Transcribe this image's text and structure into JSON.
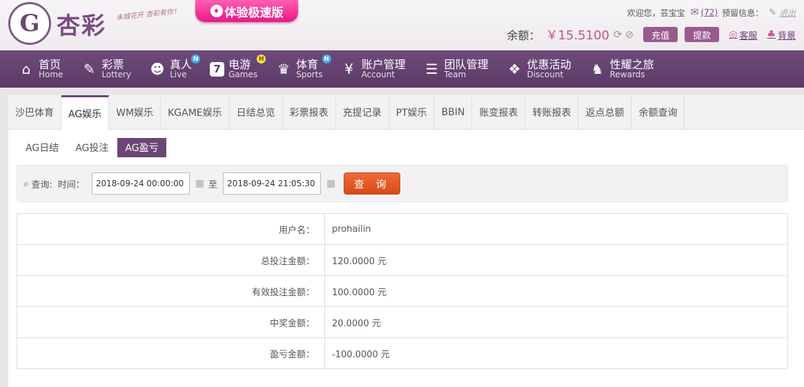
{
  "brand": {
    "logo_letter": "G",
    "name": "杏彩",
    "slogan": "未城花开 杏彩有你！",
    "promo": "体验极速版"
  },
  "topbar": {
    "welcome": "欢迎您，",
    "username": "芸宝宝",
    "message_count": "(72)",
    "reserve_info": "预留信息：",
    "logout": "退出"
  },
  "balance": {
    "label": "余额：",
    "value": "￥15.5100",
    "deposit": "充值",
    "withdraw": "提款",
    "service": "客服",
    "skin": "背景"
  },
  "nav": [
    {
      "icon": "home-icon",
      "cn": "首页",
      "en": "Home",
      "badge": ""
    },
    {
      "icon": "lottery-icon",
      "cn": "彩票",
      "en": "Lottery",
      "badge": ""
    },
    {
      "icon": "live-dealer-icon",
      "cn": "真人",
      "en": "Live",
      "badge": "N"
    },
    {
      "icon": "games-icon",
      "cn": "电游",
      "en": "Games",
      "badge": "H"
    },
    {
      "icon": "trophy-icon",
      "cn": "体育",
      "en": "Sports",
      "badge": "N"
    },
    {
      "icon": "account-icon",
      "cn": "账户管理",
      "en": "Account",
      "badge": ""
    },
    {
      "icon": "team-icon",
      "cn": "团队管理",
      "en": "Team",
      "badge": ""
    },
    {
      "icon": "gift-icon",
      "cn": "优惠活动",
      "en": "Discount",
      "badge": ""
    },
    {
      "icon": "rewards-icon",
      "cn": "性耀之旅",
      "en": "Rewards",
      "badge": ""
    }
  ],
  "tabs": [
    "沙巴体育",
    "AG娱乐",
    "WM娱乐",
    "KGAME娱乐",
    "日结总览",
    "彩票报表",
    "充提记录",
    "PT娱乐",
    "BBIN",
    "账变报表",
    "转账报表",
    "返点总额",
    "余额查询"
  ],
  "active_tab": "AG娱乐",
  "subtabs": [
    "AG日结",
    "AG投注",
    "AG盈亏"
  ],
  "active_subtab": "AG盈亏",
  "query": {
    "label": "查询:",
    "time_label": "时间：",
    "start": "2018-09-24 00:00:00",
    "to": "至",
    "end": "2018-09-24 21:05:30",
    "button": "查 询"
  },
  "result": [
    {
      "key": "用户名：",
      "value": "prohailin"
    },
    {
      "key": "总投注金额：",
      "value": "120.0000 元"
    },
    {
      "key": "有效投注金额：",
      "value": "100.0000 元"
    },
    {
      "key": "中奖金额：",
      "value": "20.0000 元"
    },
    {
      "key": "盈亏金额：",
      "value": "-100.0000 元"
    }
  ],
  "colors": {
    "brand_purple": "#6b4674",
    "nav_bg": "#5a3a66",
    "accent_pink": "#d04e8c",
    "query_button": "#e25a26"
  }
}
